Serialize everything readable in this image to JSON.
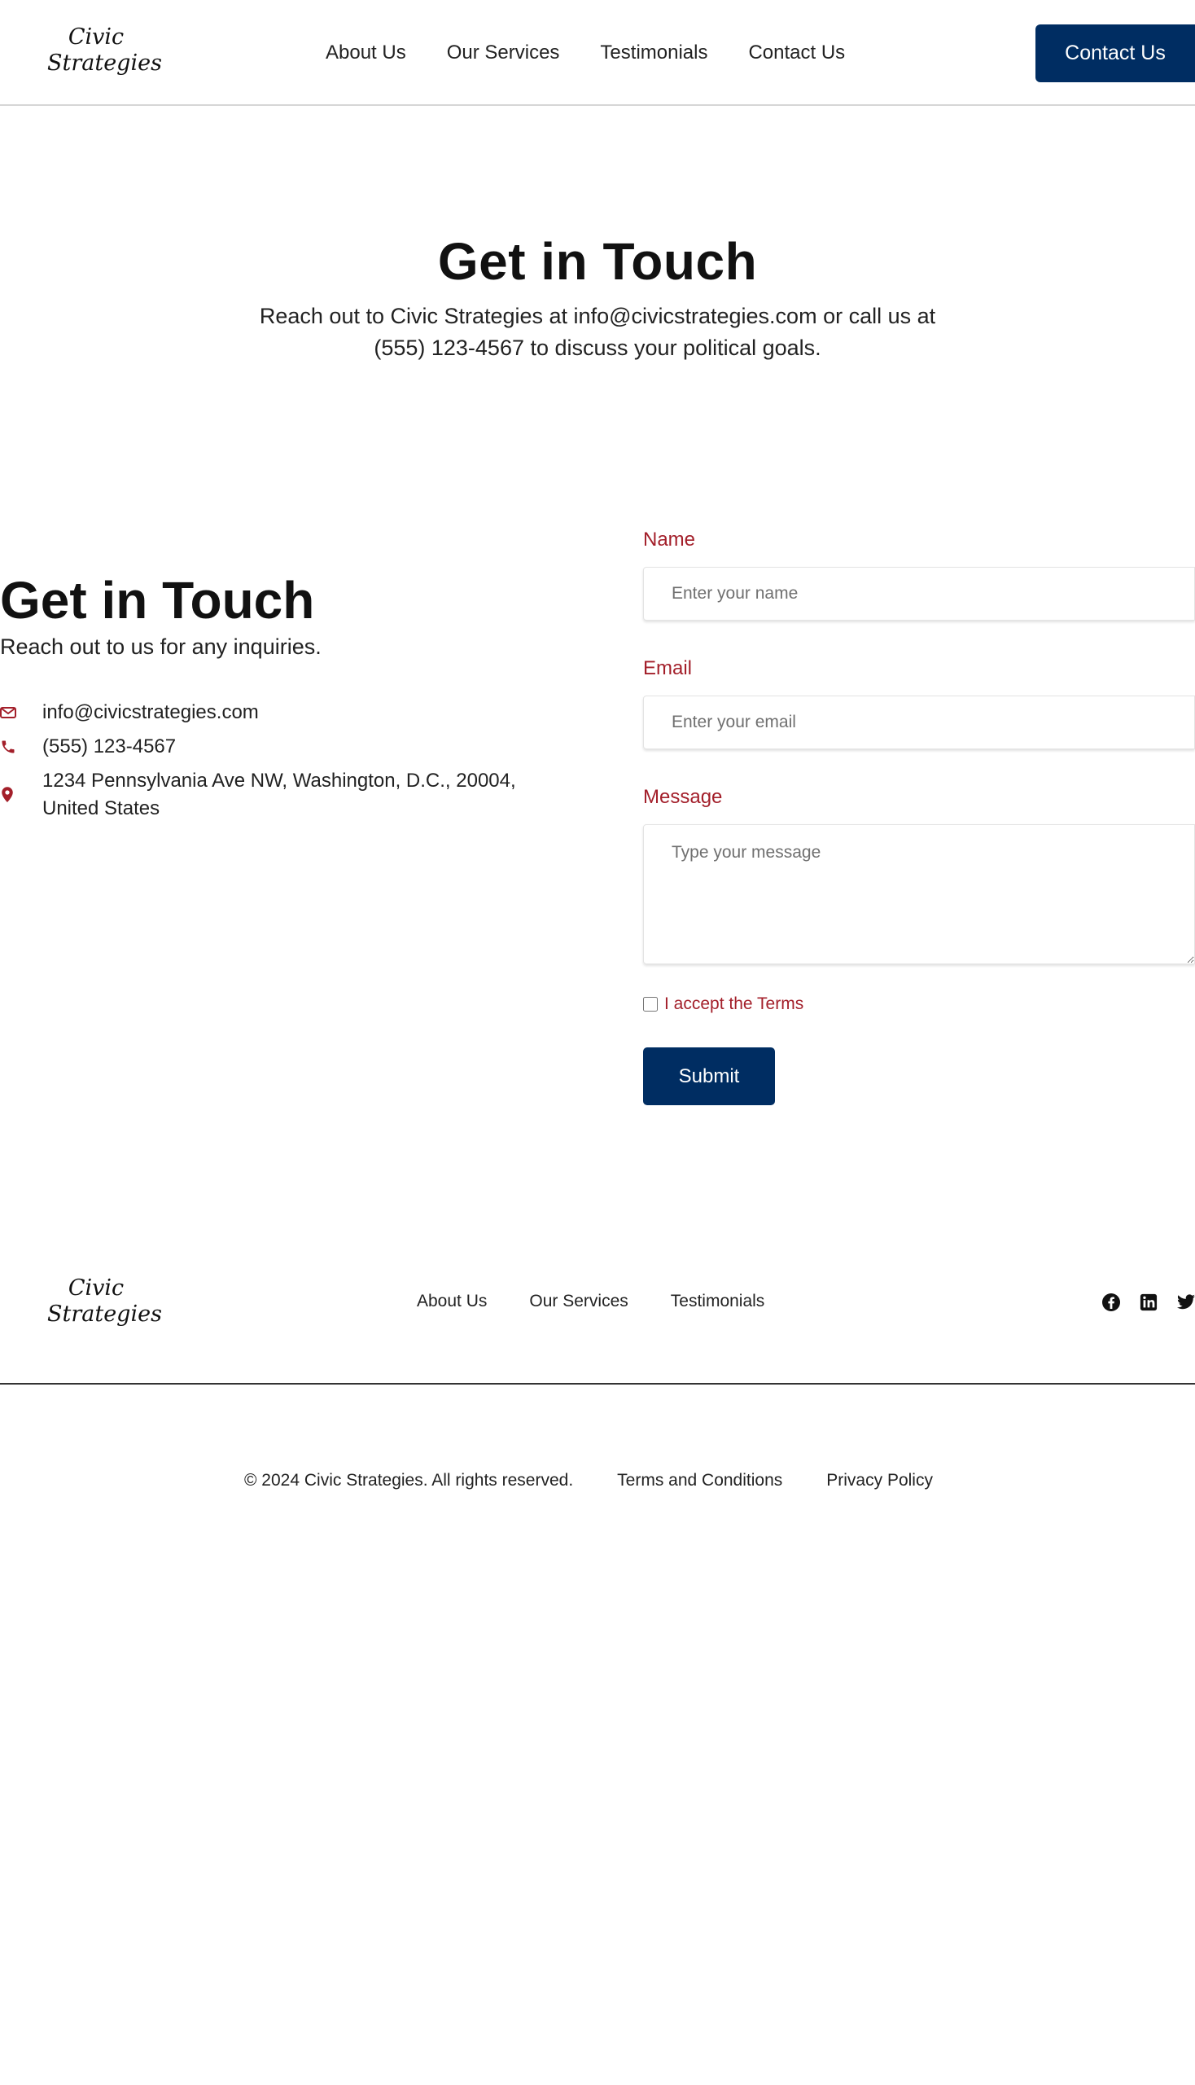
{
  "brand": {
    "logo_line1": "Civic",
    "logo_line2": "Strategies"
  },
  "header": {
    "nav": [
      "About Us",
      "Our Services",
      "Testimonials",
      "Contact Us"
    ],
    "cta_label": "Contact Us"
  },
  "hero": {
    "title": "Get in Touch",
    "description": "Reach out to Civic Strategies at info@civicstrategies.com or call us at (555) 123-4567 to discuss your political goals."
  },
  "contact": {
    "title": "Get in Touch",
    "subtitle": "Reach out to us for any inquiries.",
    "email": "info@civicstrategies.com",
    "phone": "(555) 123-4567",
    "address": "1234 Pennsylvania Ave NW, Washington, D.C., 20004, United States",
    "icons": [
      "envelope-icon",
      "phone-icon",
      "map-pin-icon"
    ]
  },
  "form": {
    "name_label": "Name",
    "name_placeholder": "Enter your name",
    "email_label": "Email",
    "email_placeholder": "Enter your email",
    "message_label": "Message",
    "message_placeholder": "Type your message",
    "terms_label": "I accept the Terms",
    "submit_label": "Submit"
  },
  "footer": {
    "nav": [
      "About Us",
      "Our Services",
      "Testimonials"
    ],
    "social_icons": [
      "facebook-icon",
      "linkedin-icon",
      "twitter-icon"
    ],
    "copyright": "© 2024 Civic Strategies. All rights reserved.",
    "terms_link": "Terms and Conditions",
    "privacy_link": "Privacy Policy"
  },
  "colors": {
    "navy": "#002d62",
    "accent_red": "#a31f2a"
  }
}
